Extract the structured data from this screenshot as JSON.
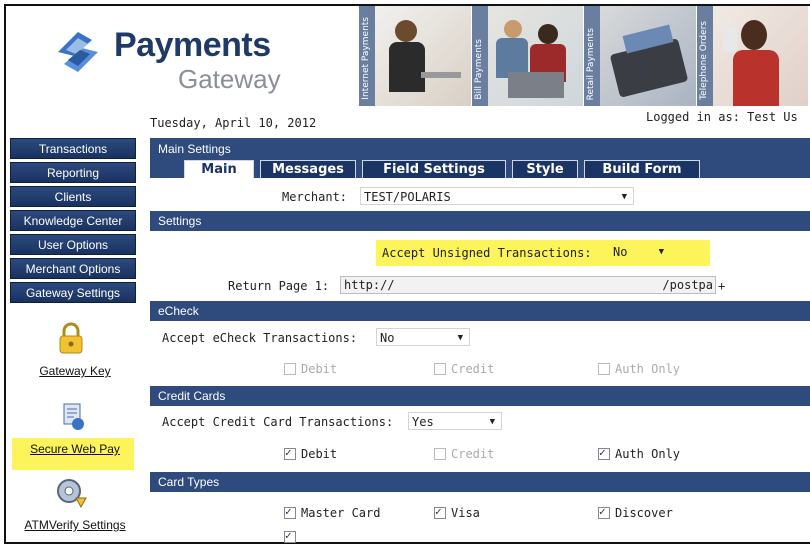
{
  "brand": {
    "title": "Payments",
    "subtitle": "Gateway"
  },
  "banner": [
    "Internet Payments",
    "Bill Payments",
    "Retail Payments",
    "Telephone Orders"
  ],
  "date": "Tuesday, April 10, 2012",
  "logged_in": "Logged in as: Test Us",
  "sidebar": {
    "items": [
      "Transactions",
      "Reporting",
      "Clients",
      "Knowledge Center",
      "User Options",
      "Merchant Options",
      "Gateway Settings"
    ],
    "links": [
      "Gateway Key",
      "Secure Web Pay",
      "ATMVerify Settings"
    ]
  },
  "main_settings": {
    "title": "Main Settings",
    "tabs": [
      "Main",
      "Messages",
      "Field Settings",
      "Style",
      "Build Form"
    ],
    "merchant_label": "Merchant:",
    "merchant_value": "TEST/POLARIS"
  },
  "settings": {
    "title": "Settings",
    "unsigned_label": "Accept Unsigned Transactions:",
    "unsigned_value": "No",
    "return_label": "Return Page 1:",
    "return_value_start": "http://",
    "return_value_end": "/postpa",
    "plus": "+"
  },
  "echeck": {
    "title": "eCheck",
    "accept_label": "Accept eCheck Transactions:",
    "accept_value": "No",
    "options": [
      "Debit",
      "Credit",
      "Auth Only"
    ]
  },
  "credit_cards": {
    "title": "Credit Cards",
    "accept_label": "Accept Credit Card Transactions:",
    "accept_value": "Yes",
    "options": [
      "Debit",
      "Credit",
      "Auth Only"
    ]
  },
  "card_types": {
    "title": "Card Types",
    "options": [
      "Master Card",
      "Visa",
      "Discover"
    ]
  },
  "colors": {
    "nav": "#2c4a7e",
    "bar": "#2f4a7d",
    "highlight": "#fdf35a"
  }
}
